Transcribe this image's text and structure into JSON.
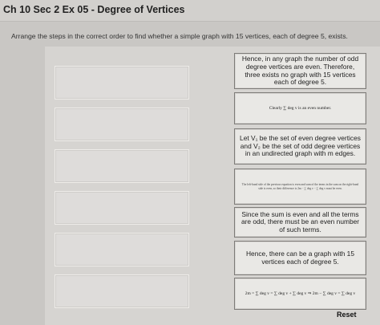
{
  "header": {
    "title": "Ch 10 Sec 2 Ex 05 - Degree of Vertices"
  },
  "instructions": "Arrange the steps in the correct order to find whether a simple graph with 15 vertices, each of degree 5, exists.",
  "cards": [
    {
      "text": "Hence, in any graph the number of odd degree vertices are even. Therefore, three exists no graph with 15 vertices each of degree 5."
    },
    {
      "text": "Clearly ∑ deg v is an even number."
    },
    {
      "text": "Let V₁ be the set of even degree vertices and V₂ be the set of odd degree vertices in an undirected graph with m edges."
    },
    {
      "text": "The left-hand side of the previous equation is even and sum of the terms in the sum on the right-hand side is even, so their difference is 2m − ∑ deg v − ∑ deg v must be even."
    },
    {
      "text": "Since the sum is even and all the terms are odd, there must be an even number of such terms."
    },
    {
      "text": "Hence, there can be a graph with 15 vertices each of degree 5."
    },
    {
      "text": "2m = ∑ deg v = ∑ deg v + ∑ deg v ⇒ 2m − ∑ deg v = ∑ deg v"
    }
  ],
  "reset_label": "Reset"
}
